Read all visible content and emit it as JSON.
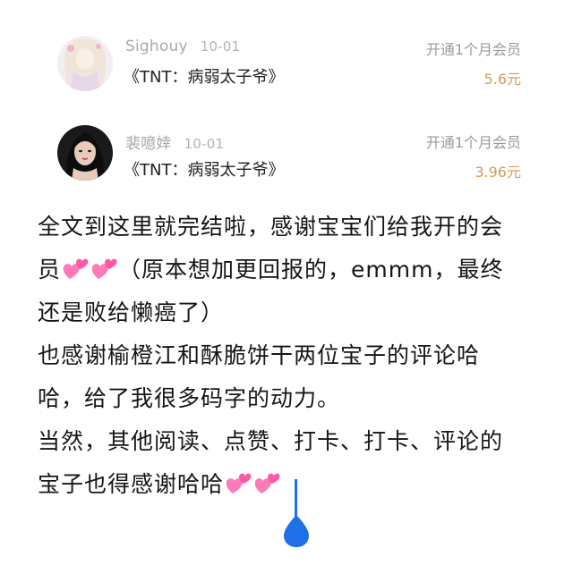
{
  "entries": [
    {
      "username": "Sighouy",
      "date": "10-01",
      "book": "《TNT：病弱太子爷》",
      "action": "开通1个月会员",
      "amount": "5.6元"
    },
    {
      "username": "裴噫婞",
      "date": "10-01",
      "book": "《TNT：病弱太子爷》",
      "action": "开通1个月会员",
      "amount": "3.96元"
    }
  ],
  "message": {
    "line1": "全文到这里就完结啦，感谢宝宝们给我开的会",
    "line2_prefix": "员",
    "line2_suffix": "（原本想加更回报的，emmm，最终",
    "line3": "还是败给懒癌了）",
    "line4": "也感谢榆橙江和酥脆饼干两位宝子的评论哈",
    "line5": "哈，给了我很多码字的动力。",
    "line6": "当然，其他阅读、点赞、打卡、打卡、评论的",
    "line7_prefix": "宝子也得感谢哈哈"
  },
  "colors": {
    "price": "#d99a54",
    "cursor": "#1e6fe8",
    "heart": "#ff6fb1"
  },
  "icons": {
    "heart": "two-hearts-emoji",
    "cursor": "text-cursor-handle"
  }
}
